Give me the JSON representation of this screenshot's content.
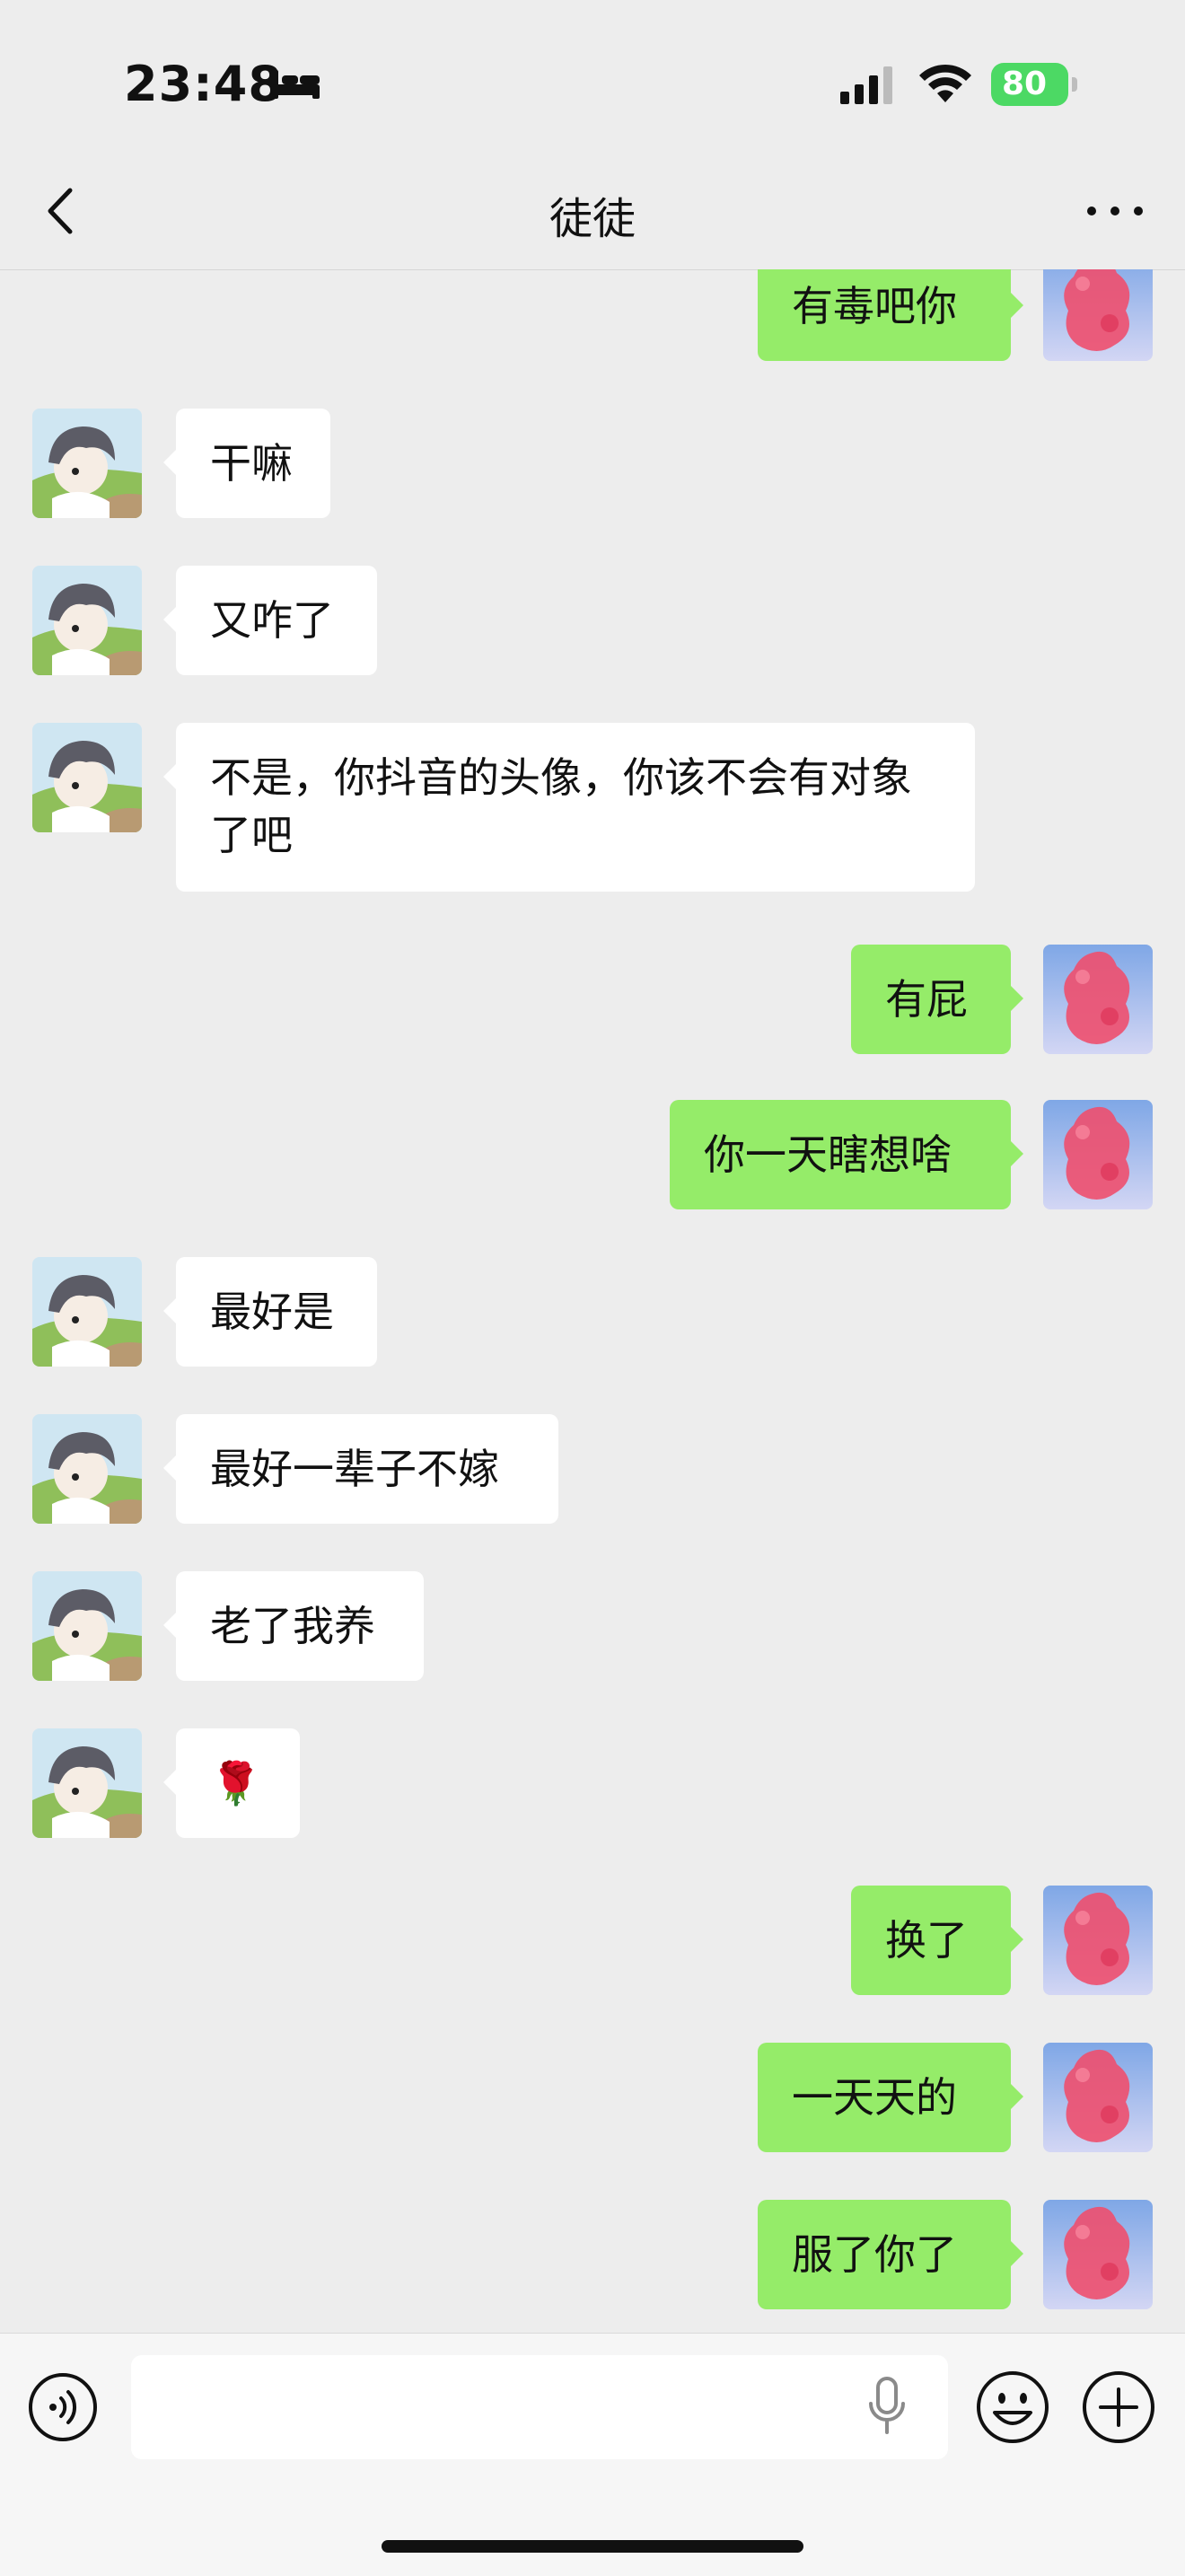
{
  "status_bar": {
    "time": "23:48",
    "battery": "80",
    "sleep_icon": "bed-icon",
    "signal_icon": "cellular-signal-icon",
    "wifi_icon": "wifi-icon"
  },
  "header": {
    "title": "徒徒",
    "back_icon": "chevron-left-icon",
    "more_icon": "ellipsis-icon"
  },
  "messages": [
    {
      "side": "right",
      "text": "有毒吧你"
    },
    {
      "side": "left",
      "text": "干嘛"
    },
    {
      "side": "left",
      "text": "又咋了"
    },
    {
      "side": "left",
      "text": "不是，你抖音的头像，你该不会有对象了吧"
    },
    {
      "side": "right",
      "text": "有屁"
    },
    {
      "side": "right",
      "text": "你一天瞎想啥"
    },
    {
      "side": "left",
      "text": "最好是"
    },
    {
      "side": "left",
      "text": "最好一辈子不嫁"
    },
    {
      "side": "left",
      "text": "老了我养"
    },
    {
      "side": "left",
      "text": "🌹"
    },
    {
      "side": "right",
      "text": "换了"
    },
    {
      "side": "right",
      "text": "一天天的"
    },
    {
      "side": "right",
      "text": "服了你了"
    }
  ],
  "input_bar": {
    "placeholder": "",
    "voice_icon": "voice-mode-icon",
    "mic_icon": "microphone-icon",
    "emoji_icon": "emoji-icon",
    "plus_icon": "plus-icon"
  },
  "colors": {
    "background": "#ededed",
    "own_bubble": "#95ec69",
    "other_bubble": "#ffffff",
    "battery": "#4cd964"
  }
}
